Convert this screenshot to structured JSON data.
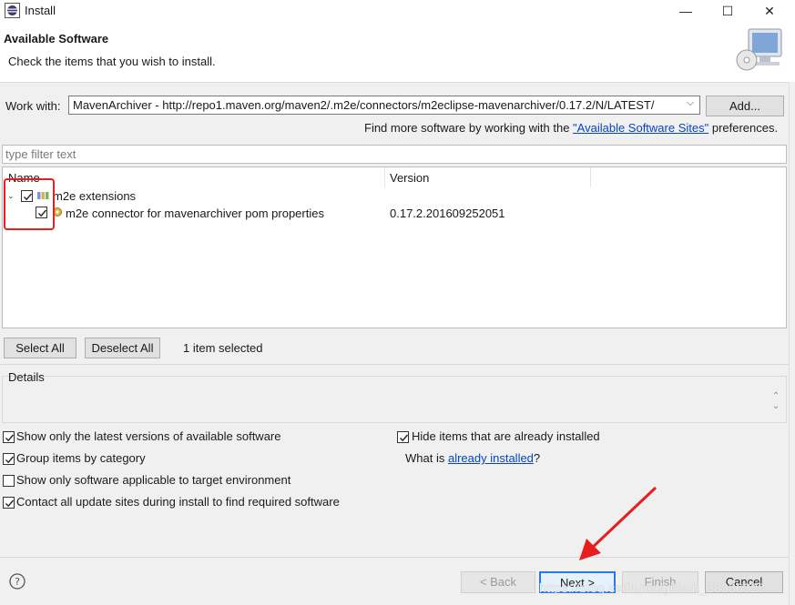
{
  "window": {
    "title": "Install",
    "minimize": "—",
    "maximize": "☐",
    "close": "✕"
  },
  "header": {
    "title": "Available Software",
    "description": "Check the items that you wish to install."
  },
  "work_with": {
    "label": "Work with:",
    "value": "MavenArchiver - http://repo1.maven.org/maven2/.m2e/connectors/m2eclipse-mavenarchiver/0.17.2/N/LATEST/",
    "add_label": "Add...",
    "more_prefix": "Find more software by working with the ",
    "more_link": "\"Available Software Sites\"",
    "more_suffix": " preferences."
  },
  "filter": {
    "placeholder": "type filter text"
  },
  "tree": {
    "columns": [
      "Name",
      "Version"
    ],
    "items": [
      {
        "label": "m2e extensions",
        "version": "",
        "checked": true
      },
      {
        "label": "m2e connector for mavenarchiver pom properties",
        "version": "0.17.2.201609252051",
        "checked": true
      }
    ]
  },
  "selection": {
    "select_all": "Select All",
    "deselect_all": "Deselect All",
    "count": "1 item selected"
  },
  "details": {
    "label": "Details"
  },
  "options": {
    "latest": "Show only the latest versions of available software",
    "group": "Group items by category",
    "target": "Show only software applicable to target environment",
    "contact": "Contact all update sites during install to find required software",
    "hide": "Hide items that are already installed",
    "what_prefix": "What is ",
    "what_link": "already installed",
    "what_suffix": "?"
  },
  "buttons": {
    "back": "< Back",
    "next": "Next >",
    "finish": "Finish",
    "cancel": "Cancel"
  },
  "watermark": "https://blog.csdn.net/github_38336328",
  "colors": {
    "annotation": "#e81e1e",
    "link": "#0645c2",
    "focus": "#2b78e4"
  }
}
